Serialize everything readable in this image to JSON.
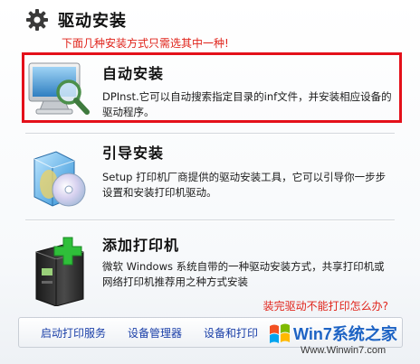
{
  "header": {
    "title": "驱动安装",
    "icon": "gear-icon"
  },
  "note": "下面几种安装方式只需选其中一种!",
  "options": [
    {
      "title": "自动安装",
      "description": "DPInst.它可以自动搜索指定目录的inf文件，并安装相应设备的驱动程序。",
      "icon": "monitor-magnifier-icon",
      "highlighted": true
    },
    {
      "title": "引导安装",
      "description": "Setup 打印机厂商提供的驱动安装工具，它可以引导你一步步设置和安装打印机驱动。",
      "icon": "software-box-cd-icon",
      "highlighted": false
    },
    {
      "title": "添加打印机",
      "description": "微软 Windows 系统自带的一种驱动安装方式，共享打印机或网络打印机推荐用之种方式安装",
      "icon": "printer-add-icon",
      "highlighted": false
    }
  ],
  "help_link": "装完驱动不能打印怎么办?",
  "toolbar": {
    "links": [
      "启动打印服务",
      "设备管理器",
      "设备和打印"
    ]
  },
  "watermark": {
    "brand": "Win7系统之家",
    "url": "Www.Winwin7.com"
  },
  "colors": {
    "accent_red": "#e4101a",
    "link_blue": "#1a3fa8",
    "note_red": "#e0231a"
  }
}
